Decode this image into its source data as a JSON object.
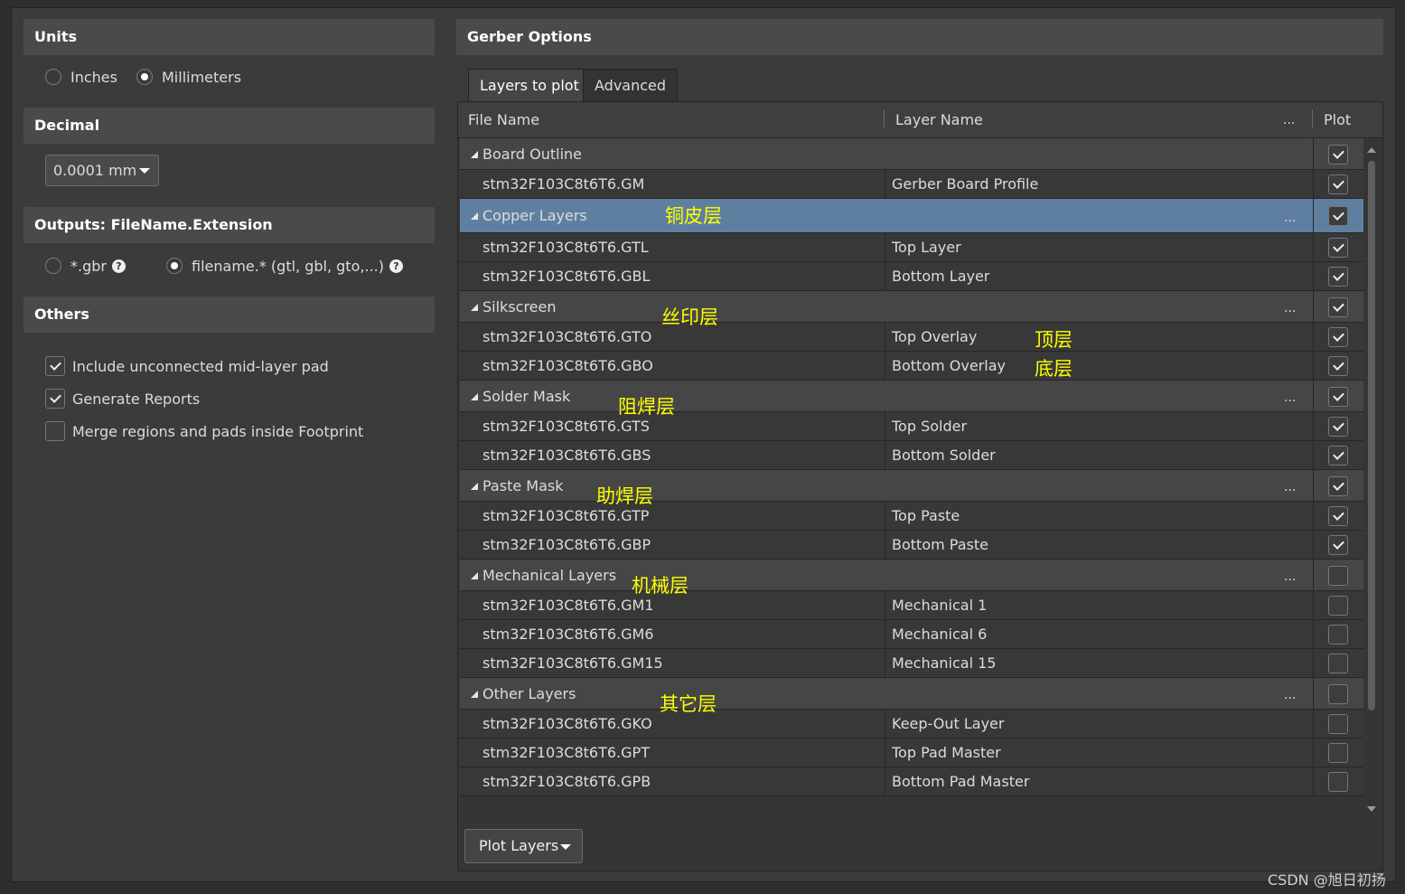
{
  "units": {
    "title": "Units",
    "options": [
      {
        "label": "Inches",
        "selected": false
      },
      {
        "label": "Millimeters",
        "selected": true
      }
    ]
  },
  "decimal": {
    "title": "Decimal",
    "value": "0.0001 mm"
  },
  "outputs": {
    "title": "Outputs: FileName.Extension",
    "options": [
      {
        "label": "*.gbr",
        "selected": false
      },
      {
        "label": "filename.* (gtl, gbl, gto,...)",
        "selected": true
      }
    ]
  },
  "others": {
    "title": "Others",
    "options": [
      {
        "label": "Include unconnected mid-layer pad",
        "checked": true
      },
      {
        "label": "Generate Reports",
        "checked": true
      },
      {
        "label": "Merge regions and pads inside Footprint",
        "checked": false
      }
    ]
  },
  "gerber": {
    "title": "Gerber Options",
    "tabs": [
      {
        "label": "Layers to plot",
        "active": true
      },
      {
        "label": "Advanced",
        "active": false
      }
    ],
    "columns": {
      "file": "File Name",
      "layer": "Layer Name",
      "more": "...",
      "plot": "Plot"
    },
    "rows": [
      {
        "type": "group",
        "name": "Board Outline",
        "plot": true
      },
      {
        "type": "item",
        "file": "stm32F103C8t6T6.GM",
        "layer": "Gerber Board Profile",
        "plot": true
      },
      {
        "type": "group",
        "name": "Copper Layers",
        "more": "...",
        "plot": true,
        "selected": true,
        "annotation": "铜皮层"
      },
      {
        "type": "item",
        "file": "stm32F103C8t6T6.GTL",
        "layer": "Top Layer",
        "plot": true
      },
      {
        "type": "item",
        "file": "stm32F103C8t6T6.GBL",
        "layer": "Bottom Layer",
        "plot": true
      },
      {
        "type": "group",
        "name": "Silkscreen",
        "more": "...",
        "plot": true,
        "annotation": "丝印层"
      },
      {
        "type": "item",
        "file": "stm32F103C8t6T6.GTO",
        "layer": "Top Overlay",
        "plot": true,
        "annotation": "顶层"
      },
      {
        "type": "item",
        "file": "stm32F103C8t6T6.GBO",
        "layer": "Bottom Overlay",
        "plot": true,
        "annotation": "底层"
      },
      {
        "type": "group",
        "name": "Solder Mask",
        "more": "...",
        "plot": true,
        "annotation": "阻焊层"
      },
      {
        "type": "item",
        "file": "stm32F103C8t6T6.GTS",
        "layer": "Top Solder",
        "plot": true
      },
      {
        "type": "item",
        "file": "stm32F103C8t6T6.GBS",
        "layer": "Bottom Solder",
        "plot": true
      },
      {
        "type": "group",
        "name": "Paste Mask",
        "more": "...",
        "plot": true,
        "annotation": "助焊层"
      },
      {
        "type": "item",
        "file": "stm32F103C8t6T6.GTP",
        "layer": "Top Paste",
        "plot": true
      },
      {
        "type": "item",
        "file": "stm32F103C8t6T6.GBP",
        "layer": "Bottom Paste",
        "plot": true
      },
      {
        "type": "group",
        "name": "Mechanical Layers",
        "more": "...",
        "plot": false,
        "annotation": "机械层"
      },
      {
        "type": "item",
        "file": "stm32F103C8t6T6.GM1",
        "layer": "Mechanical 1",
        "plot": false
      },
      {
        "type": "item",
        "file": "stm32F103C8t6T6.GM6",
        "layer": "Mechanical 6",
        "plot": false
      },
      {
        "type": "item",
        "file": "stm32F103C8t6T6.GM15",
        "layer": "Mechanical 15",
        "plot": false
      },
      {
        "type": "group",
        "name": "Other Layers",
        "more": "...",
        "plot": false,
        "annotation": "其它层"
      },
      {
        "type": "item",
        "file": "stm32F103C8t6T6.GKO",
        "layer": "Keep-Out Layer",
        "plot": false
      },
      {
        "type": "item",
        "file": "stm32F103C8t6T6.GPT",
        "layer": "Top Pad Master",
        "plot": false
      },
      {
        "type": "item",
        "file": "stm32F103C8t6T6.GPB",
        "layer": "Bottom Pad Master",
        "plot": false
      }
    ],
    "plot_button": "Plot Layers"
  },
  "watermark": "CSDN @旭日初扬",
  "colors": {
    "selected_row": "#5f7fa0",
    "annotation": "#ffff00"
  }
}
